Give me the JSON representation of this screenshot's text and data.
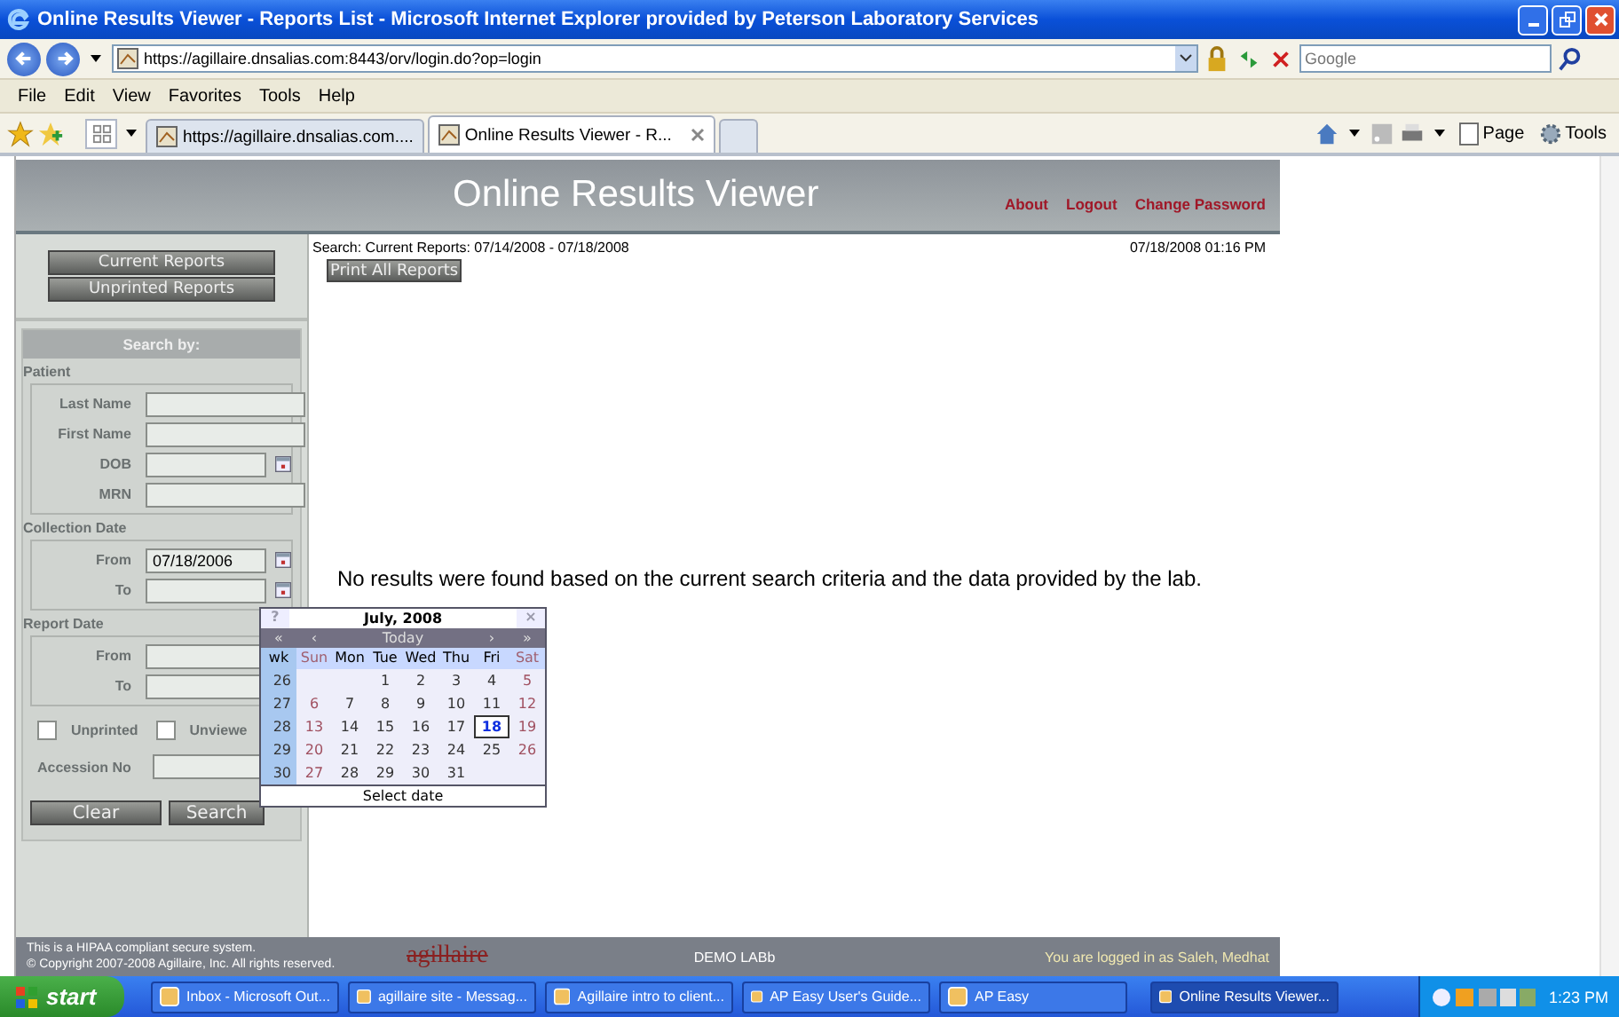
{
  "window": {
    "title": "Online Results Viewer - Reports List - Microsoft Internet Explorer provided by Peterson Laboratory Services"
  },
  "address_bar": {
    "url": "https://agillaire.dnsalias.com:8443/orv/login.do?op=login",
    "search_placeholder": "Google"
  },
  "menu": [
    "File",
    "Edit",
    "View",
    "Favorites",
    "Tools",
    "Help"
  ],
  "tabs": [
    {
      "label": "https://agillaire.dnsalias.com....",
      "selected": false
    },
    {
      "label": "Online Results Viewer - R...",
      "selected": true
    }
  ],
  "command_bar": {
    "page": "Page",
    "tools": "Tools"
  },
  "page": {
    "title": "Online Results Viewer",
    "links": [
      "About",
      "Logout",
      "Change Password"
    ],
    "nav_buttons": [
      "Current Reports",
      "Unprinted Reports"
    ],
    "search_heading": "Search by:",
    "sections": [
      {
        "title": "Patient",
        "fields": [
          {
            "label": "Last Name",
            "calendar": false
          },
          {
            "label": "First Name",
            "calendar": false
          },
          {
            "label": "DOB",
            "calendar": true
          },
          {
            "label": "MRN",
            "calendar": false
          }
        ]
      },
      {
        "title": "Collection Date",
        "fields": [
          {
            "label": "From",
            "value": "07/18/2006",
            "calendar": true
          },
          {
            "label": "To",
            "calendar": true
          }
        ]
      },
      {
        "title": "Report Date",
        "fields": [
          {
            "label": "From"
          },
          {
            "label": "To"
          }
        ]
      }
    ],
    "checkboxes": [
      {
        "label": "Unprinted",
        "checked": false
      },
      {
        "label": "Unviewe",
        "checked": false
      }
    ],
    "accession_label": "Accession No",
    "actions": [
      "Clear",
      "Search"
    ],
    "search_summary": "Search: Current Reports: 07/14/2008 - 07/18/2008",
    "timestamp": "07/18/2008 01:16 PM",
    "print_button": "Print All Reports",
    "message": "No results were found based on the current search criteria and the data provided by the lab.",
    "footer": {
      "notice": [
        "This is a HIPAA compliant secure system.",
        "© Copyright 2007-2008 Agillaire, Inc. All rights reserved."
      ],
      "logo": "agillaire",
      "lab": "DEMO LABb",
      "user": "You are logged in as Saleh, Medhat"
    }
  },
  "calendar": {
    "help": "?",
    "month": "July, 2008",
    "close": "×",
    "nav": [
      "«",
      "‹",
      "Today",
      "›",
      "»"
    ],
    "week_label": "wk",
    "weekdays": [
      {
        "label": "Sun",
        "kind": "weekend"
      },
      {
        "label": "Mon",
        "kind": "weekday"
      },
      {
        "label": "Tue",
        "kind": "weekday"
      },
      {
        "label": "Wed",
        "kind": "weekday"
      },
      {
        "label": "Thu",
        "kind": "weekday"
      },
      {
        "label": "Fri",
        "kind": "weekday"
      },
      {
        "label": "Sat",
        "kind": "weekend"
      }
    ],
    "weeks": [
      {
        "number": "26",
        "days": [
          {
            "kind": "blank"
          },
          {
            "kind": "blank"
          },
          {
            "kind": "weekday",
            "text": "1",
            "selected": false
          },
          {
            "kind": "weekday",
            "text": "2",
            "selected": false
          },
          {
            "kind": "weekday",
            "text": "3",
            "selected": false
          },
          {
            "kind": "weekday",
            "text": "4",
            "selected": false
          },
          {
            "kind": "weekend",
            "text": "5",
            "selected": false
          }
        ]
      },
      {
        "number": "27",
        "days": [
          {
            "kind": "weekend",
            "text": "6",
            "selected": false
          },
          {
            "kind": "weekday",
            "text": "7",
            "selected": false
          },
          {
            "kind": "weekday",
            "text": "8",
            "selected": false
          },
          {
            "kind": "weekday",
            "text": "9",
            "selected": false
          },
          {
            "kind": "weekday",
            "text": "10",
            "selected": false
          },
          {
            "kind": "weekday",
            "text": "11",
            "selected": false
          },
          {
            "kind": "weekend",
            "text": "12",
            "selected": false
          }
        ]
      },
      {
        "number": "28",
        "days": [
          {
            "kind": "weekend",
            "text": "13",
            "selected": false
          },
          {
            "kind": "weekday",
            "text": "14",
            "selected": false
          },
          {
            "kind": "weekday",
            "text": "15",
            "selected": false
          },
          {
            "kind": "weekday",
            "text": "16",
            "selected": false
          },
          {
            "kind": "weekday",
            "text": "17",
            "selected": false
          },
          {
            "kind": "weekday",
            "text": "18",
            "selected": true
          },
          {
            "kind": "weekend",
            "text": "19",
            "selected": false
          }
        ]
      },
      {
        "number": "29",
        "days": [
          {
            "kind": "weekend",
            "text": "20",
            "selected": false
          },
          {
            "kind": "weekday",
            "text": "21",
            "selected": false
          },
          {
            "kind": "weekday",
            "text": "22",
            "selected": false
          },
          {
            "kind": "weekday",
            "text": "23",
            "selected": false
          },
          {
            "kind": "weekday",
            "text": "24",
            "selected": false
          },
          {
            "kind": "weekday",
            "text": "25",
            "selected": false
          },
          {
            "kind": "weekend",
            "text": "26",
            "selected": false
          }
        ]
      },
      {
        "number": "30",
        "days": [
          {
            "kind": "weekend",
            "text": "27",
            "selected": false
          },
          {
            "kind": "weekday",
            "text": "28",
            "selected": false
          },
          {
            "kind": "weekday",
            "text": "29",
            "selected": false
          },
          {
            "kind": "weekday",
            "text": "30",
            "selected": false
          },
          {
            "kind": "weekday",
            "text": "31",
            "selected": false
          },
          {
            "kind": "blank"
          },
          {
            "kind": "blank"
          }
        ]
      }
    ],
    "footer": "Select date"
  },
  "taskbar": {
    "start": "start",
    "items": [
      {
        "label": "Inbox - Microsoft Out...",
        "selected": false
      },
      {
        "label": "agillaire site - Messag...",
        "selected": false
      },
      {
        "label": "Agillaire intro to client...",
        "selected": false
      },
      {
        "label": "AP Easy User's Guide...",
        "selected": false
      },
      {
        "label": "AP Easy",
        "selected": false
      },
      {
        "label": "Online Results Viewer...",
        "selected": true
      }
    ],
    "time": "1:23 PM"
  }
}
